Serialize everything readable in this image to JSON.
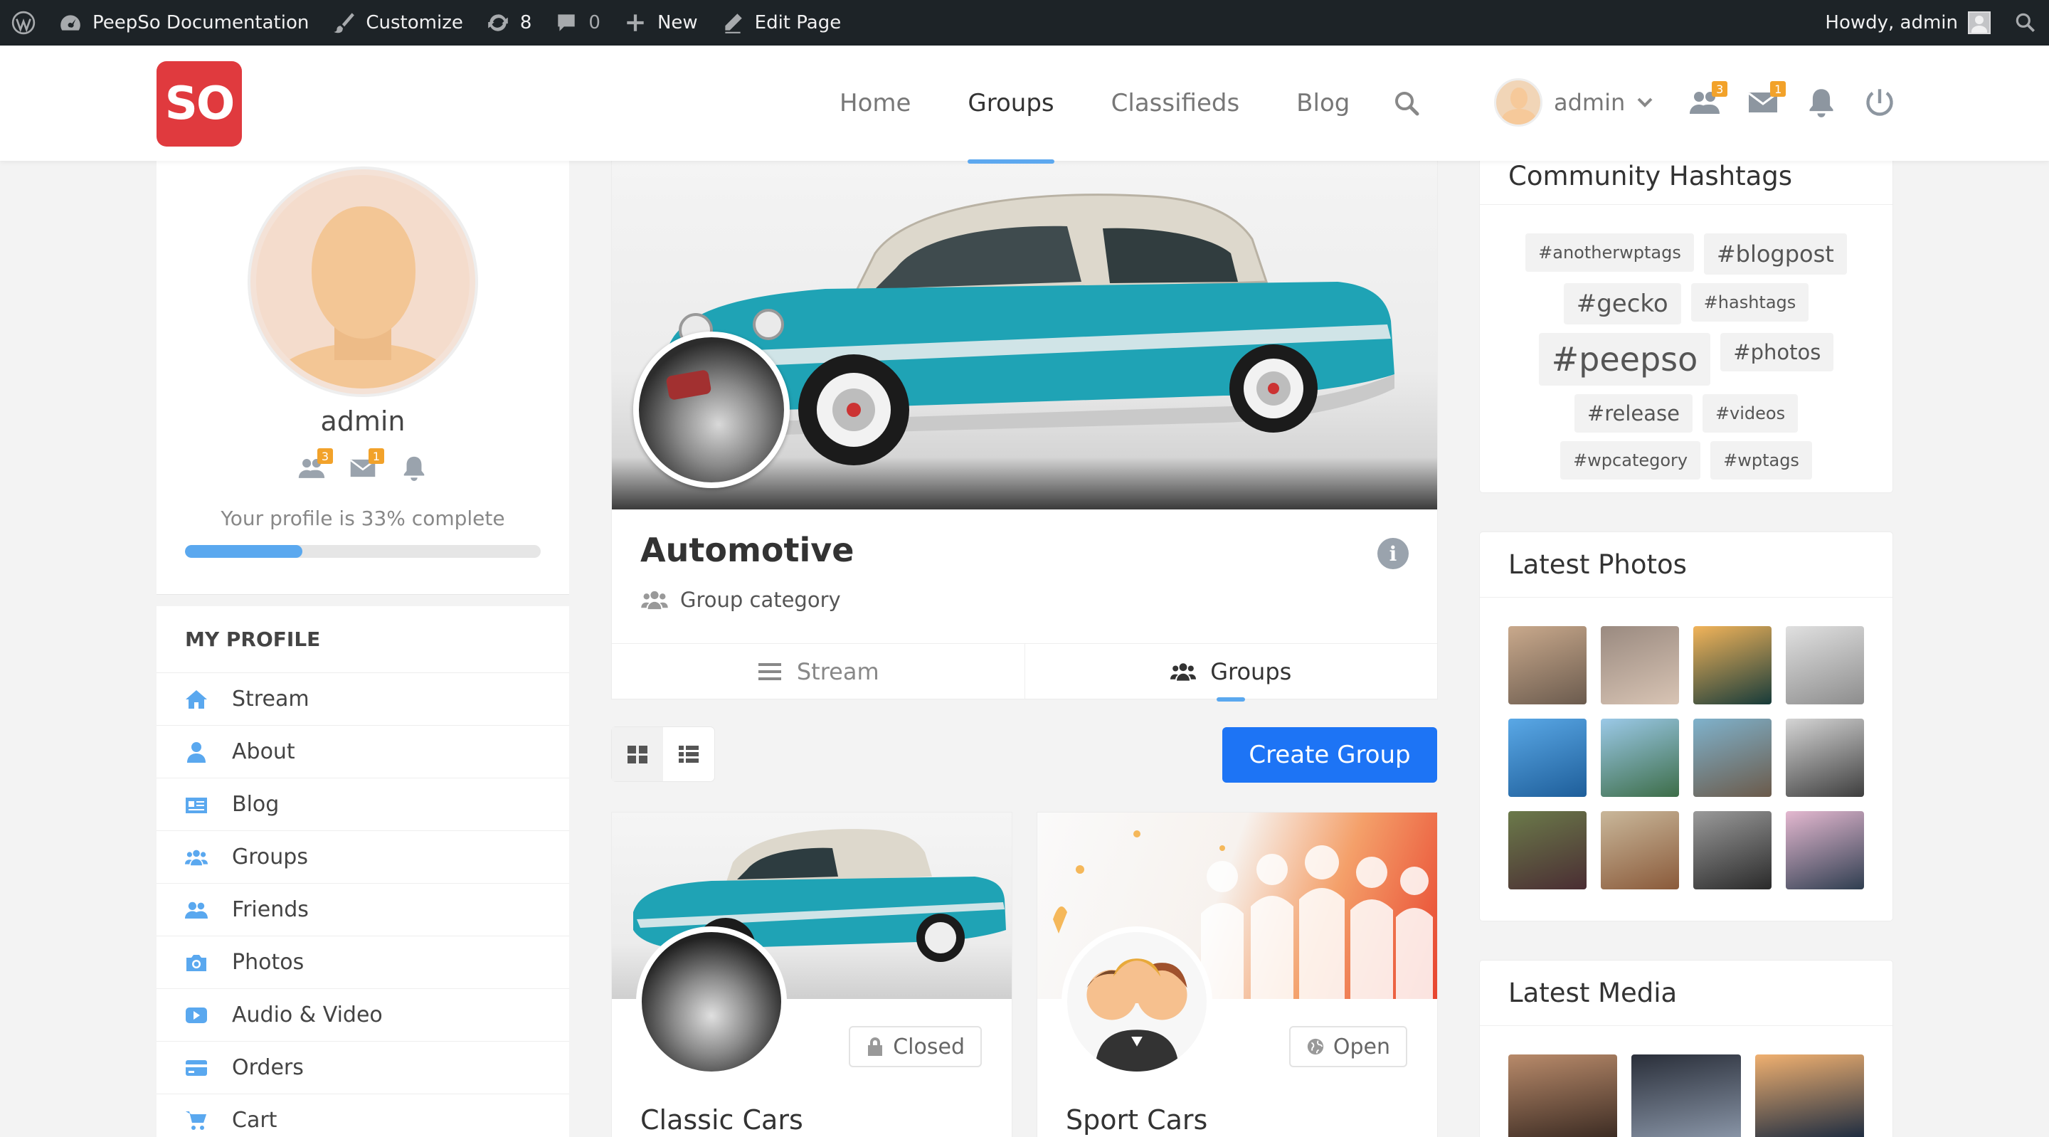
{
  "adminbar": {
    "site_name": "PeepSo Documentation",
    "customize": "Customize",
    "updates_count": "8",
    "comments_count": "0",
    "new_label": "New",
    "edit_page": "Edit Page",
    "howdy": "Howdy, admin"
  },
  "header": {
    "logo_text": "SO",
    "nav": [
      "Home",
      "Groups",
      "Classifieds",
      "Blog"
    ],
    "active_nav": "Groups",
    "user_name": "admin",
    "friends_badge": "3",
    "messages_badge": "1"
  },
  "profile": {
    "name": "admin",
    "friends_badge": "3",
    "messages_badge": "1",
    "completion_text": "Your profile is 33% complete",
    "completion_percent": 33
  },
  "menu": {
    "title": "MY PROFILE",
    "items": [
      {
        "label": "Stream",
        "icon": "home-icon"
      },
      {
        "label": "About",
        "icon": "user-icon"
      },
      {
        "label": "Blog",
        "icon": "blog-icon"
      },
      {
        "label": "Groups",
        "icon": "groups-icon"
      },
      {
        "label": "Friends",
        "icon": "friends-icon"
      },
      {
        "label": "Photos",
        "icon": "camera-icon"
      },
      {
        "label": "Audio & Video",
        "icon": "video-icon"
      },
      {
        "label": "Orders",
        "icon": "card-icon"
      },
      {
        "label": "Cart",
        "icon": "cart-icon"
      }
    ]
  },
  "group": {
    "title": "Automotive",
    "category_label": "Group category",
    "tabs": [
      {
        "label": "Stream",
        "icon": "stream-icon"
      },
      {
        "label": "Groups",
        "icon": "groups-icon"
      }
    ],
    "active_tab": "Groups",
    "create_button": "Create Group"
  },
  "groups_list": [
    {
      "name": "Classic Cars",
      "status": "Closed",
      "status_icon": "lock-icon"
    },
    {
      "name": "Sport Cars",
      "status": "Open",
      "status_icon": "globe-icon"
    }
  ],
  "hashtags": {
    "title": "Community Hashtags",
    "tags": [
      {
        "text": "#anotherwptags",
        "size": "small"
      },
      {
        "text": "#blogpost",
        "size": "medium"
      },
      {
        "text": "#gecko",
        "size": "large"
      },
      {
        "text": "#hashtags",
        "size": "small"
      },
      {
        "text": "#peepso",
        "size": "xlarge"
      },
      {
        "text": "#photos",
        "size": "medium-small"
      },
      {
        "text": "#release",
        "size": "medium-small"
      },
      {
        "text": "#videos",
        "size": "small"
      },
      {
        "text": "#wpcategory",
        "size": "small"
      },
      {
        "text": "#wptags",
        "size": "small"
      }
    ]
  },
  "latest_photos": {
    "title": "Latest Photos",
    "colors": [
      [
        "#c9a98c",
        "#6b5b4e"
      ],
      [
        "#9a8a80",
        "#d8c4b4"
      ],
      [
        "#f2b45a",
        "#173b3a"
      ],
      [
        "#e0e0e0",
        "#8d8d8d"
      ],
      [
        "#5aa8e6",
        "#1e5e9a"
      ],
      [
        "#9bc9e8",
        "#3d6d48"
      ],
      [
        "#7fb2cc",
        "#6b5a4a"
      ],
      [
        "#d5d5d5",
        "#3e3e3e"
      ],
      [
        "#6b7a4a",
        "#4a2d33"
      ],
      [
        "#c9b79a",
        "#8a5a3a"
      ],
      [
        "#9a9a9a",
        "#2a2a2a"
      ],
      [
        "#e4b8d0",
        "#2f3e50"
      ]
    ]
  },
  "latest_media": {
    "title": "Latest Media",
    "colors": [
      [
        "#b88a6a",
        "#3a2a22"
      ],
      [
        "#2a2f3a",
        "#8a96a8"
      ],
      [
        "#f0b070",
        "#1a2a40"
      ]
    ]
  }
}
